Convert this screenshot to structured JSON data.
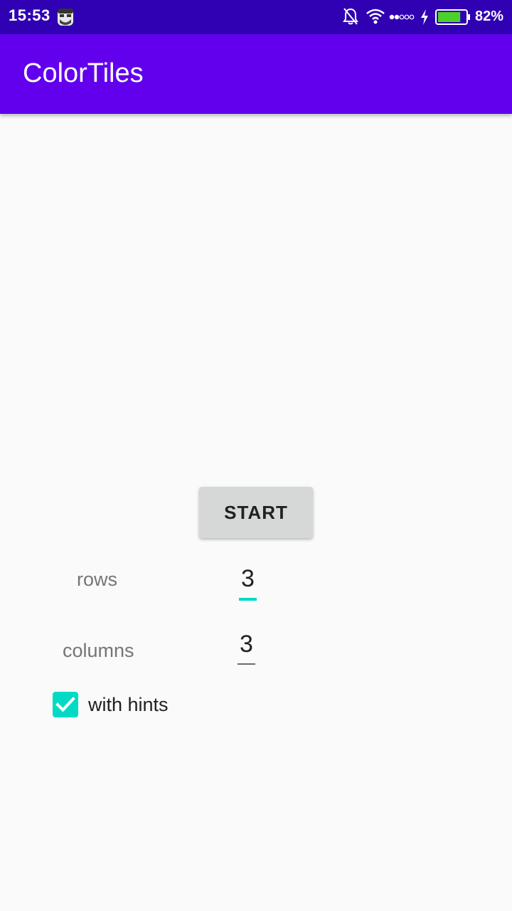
{
  "status_bar": {
    "time": "15:53",
    "battery_percent": "82%",
    "battery_level": 0.82,
    "icons": [
      "notifications-off-icon",
      "wifi-icon",
      "signal-dots-icon",
      "charging-icon",
      "battery-icon"
    ],
    "background_color": "#3000b3"
  },
  "app_bar": {
    "title": "ColorTiles",
    "background_color": "#6200ee"
  },
  "main": {
    "start_label": "START",
    "rows_label": "rows",
    "rows_value": "3",
    "columns_label": "columns",
    "columns_value": "3",
    "hints_label": "with hints",
    "hints_checked": true,
    "accent_color": "#03dac5"
  }
}
